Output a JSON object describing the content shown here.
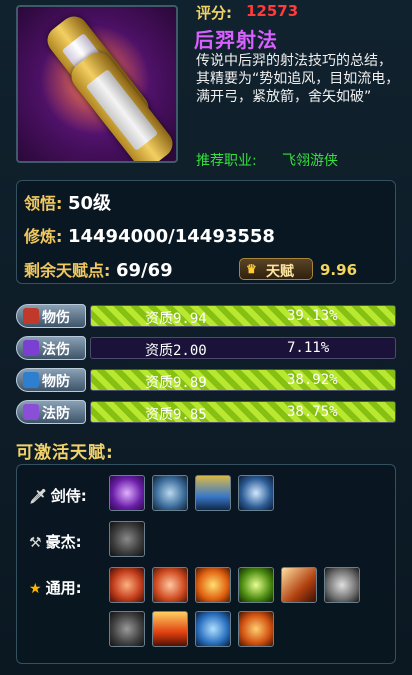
{
  "header": {
    "score_label": "评分:",
    "score_value": "12573",
    "skill_name": "后羿射法",
    "description": "传说中后羿的射法技巧的总结，其精要为“势如追风，目如流电，满开弓，紧放箭，舍矢如破”",
    "recommend_label": "推荐职业:",
    "recommend_value": "飞翎游侠",
    "icon": "scroll-icon"
  },
  "stats": {
    "comprehension_label": "领悟:",
    "comprehension_value": "50级",
    "cultivation_label": "修炼:",
    "cultivation_value": "14494000/14493558",
    "remaining_label": "剩余天赋点:",
    "remaining_value": "69/69",
    "talent_button_label": "天赋",
    "talent_score": "9.96"
  },
  "attributes": [
    {
      "label": "物伤",
      "icon": "sword-icon",
      "quality": "资质9.94",
      "percent": "39.13%",
      "fill": 1.0,
      "color": "#c0392b"
    },
    {
      "label": "法伤",
      "icon": "magic-icon",
      "quality": "资质2.00",
      "percent": "7.11%",
      "fill": 0.0,
      "color": "#7b3fd1"
    },
    {
      "label": "物防",
      "icon": "shield-icon",
      "quality": "资质9.89",
      "percent": "38.92%",
      "fill": 1.0,
      "color": "#2f7fd0"
    },
    {
      "label": "法防",
      "icon": "magic-shield-icon",
      "quality": "资质9.85",
      "percent": "38.75%",
      "fill": 1.0,
      "color": "#8a4fd6"
    }
  ],
  "talents": {
    "title": "可激活天赋:",
    "groups": [
      {
        "label": "剑侍:",
        "icon": "sword-icon"
      },
      {
        "label": "豪杰:",
        "icon": "axe-icon"
      },
      {
        "label": "通用:",
        "icon": "star-icon"
      }
    ]
  }
}
